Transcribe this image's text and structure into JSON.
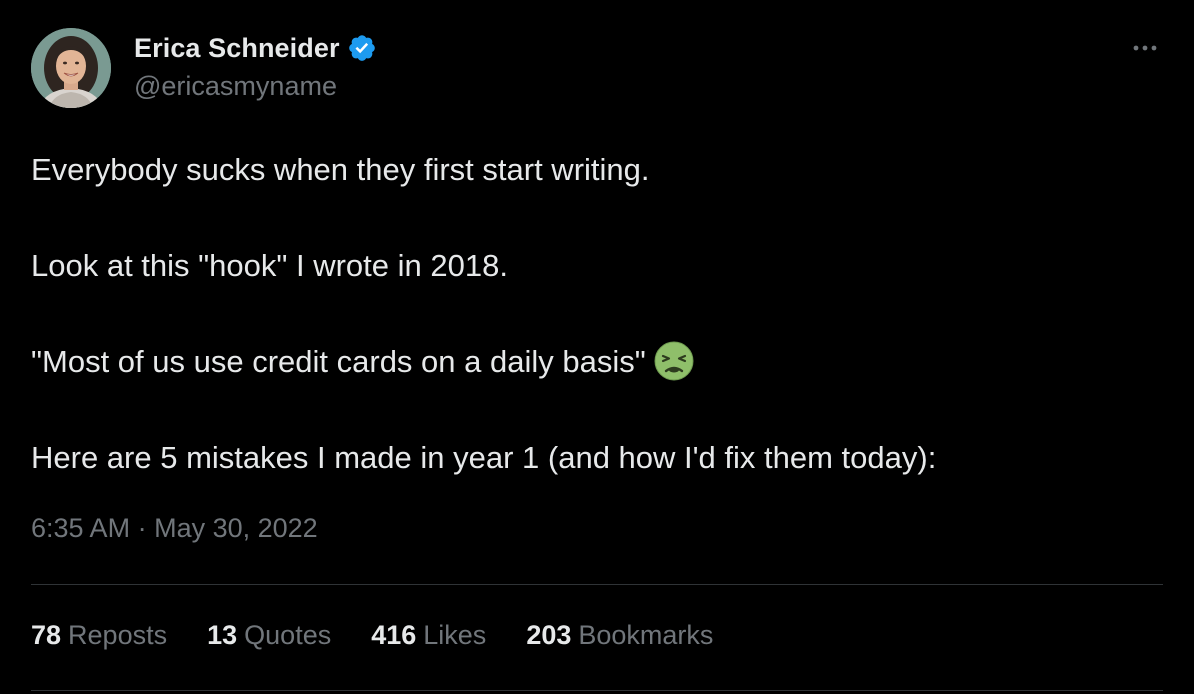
{
  "author": {
    "display_name": "Erica Schneider",
    "handle": "@ericasmyname",
    "verified_icon": "verified-badge-icon",
    "verified_color": "#1d9bf0"
  },
  "tweet": {
    "lines": [
      "Everybody sucks when they first start writing.",
      "Look at this \"hook\" I wrote in 2018.",
      "\"Most of us use credit cards on a daily basis\"",
      "Here are 5 mistakes I made in year 1 (and how I'd fix them today):"
    ],
    "emoji": "nauseated-face-icon",
    "time": "6:35 AM",
    "separator": "·",
    "date": "May 30, 2022"
  },
  "stats": {
    "reposts": {
      "count": "78",
      "label": "Reposts"
    },
    "quotes": {
      "count": "13",
      "label": "Quotes"
    },
    "likes": {
      "count": "416",
      "label": "Likes"
    },
    "bookmarks": {
      "count": "203",
      "label": "Bookmarks"
    }
  },
  "colors": {
    "background": "#000000",
    "text": "#e7e9ea",
    "secondary_text": "#71767b",
    "divider": "#2f3336"
  }
}
